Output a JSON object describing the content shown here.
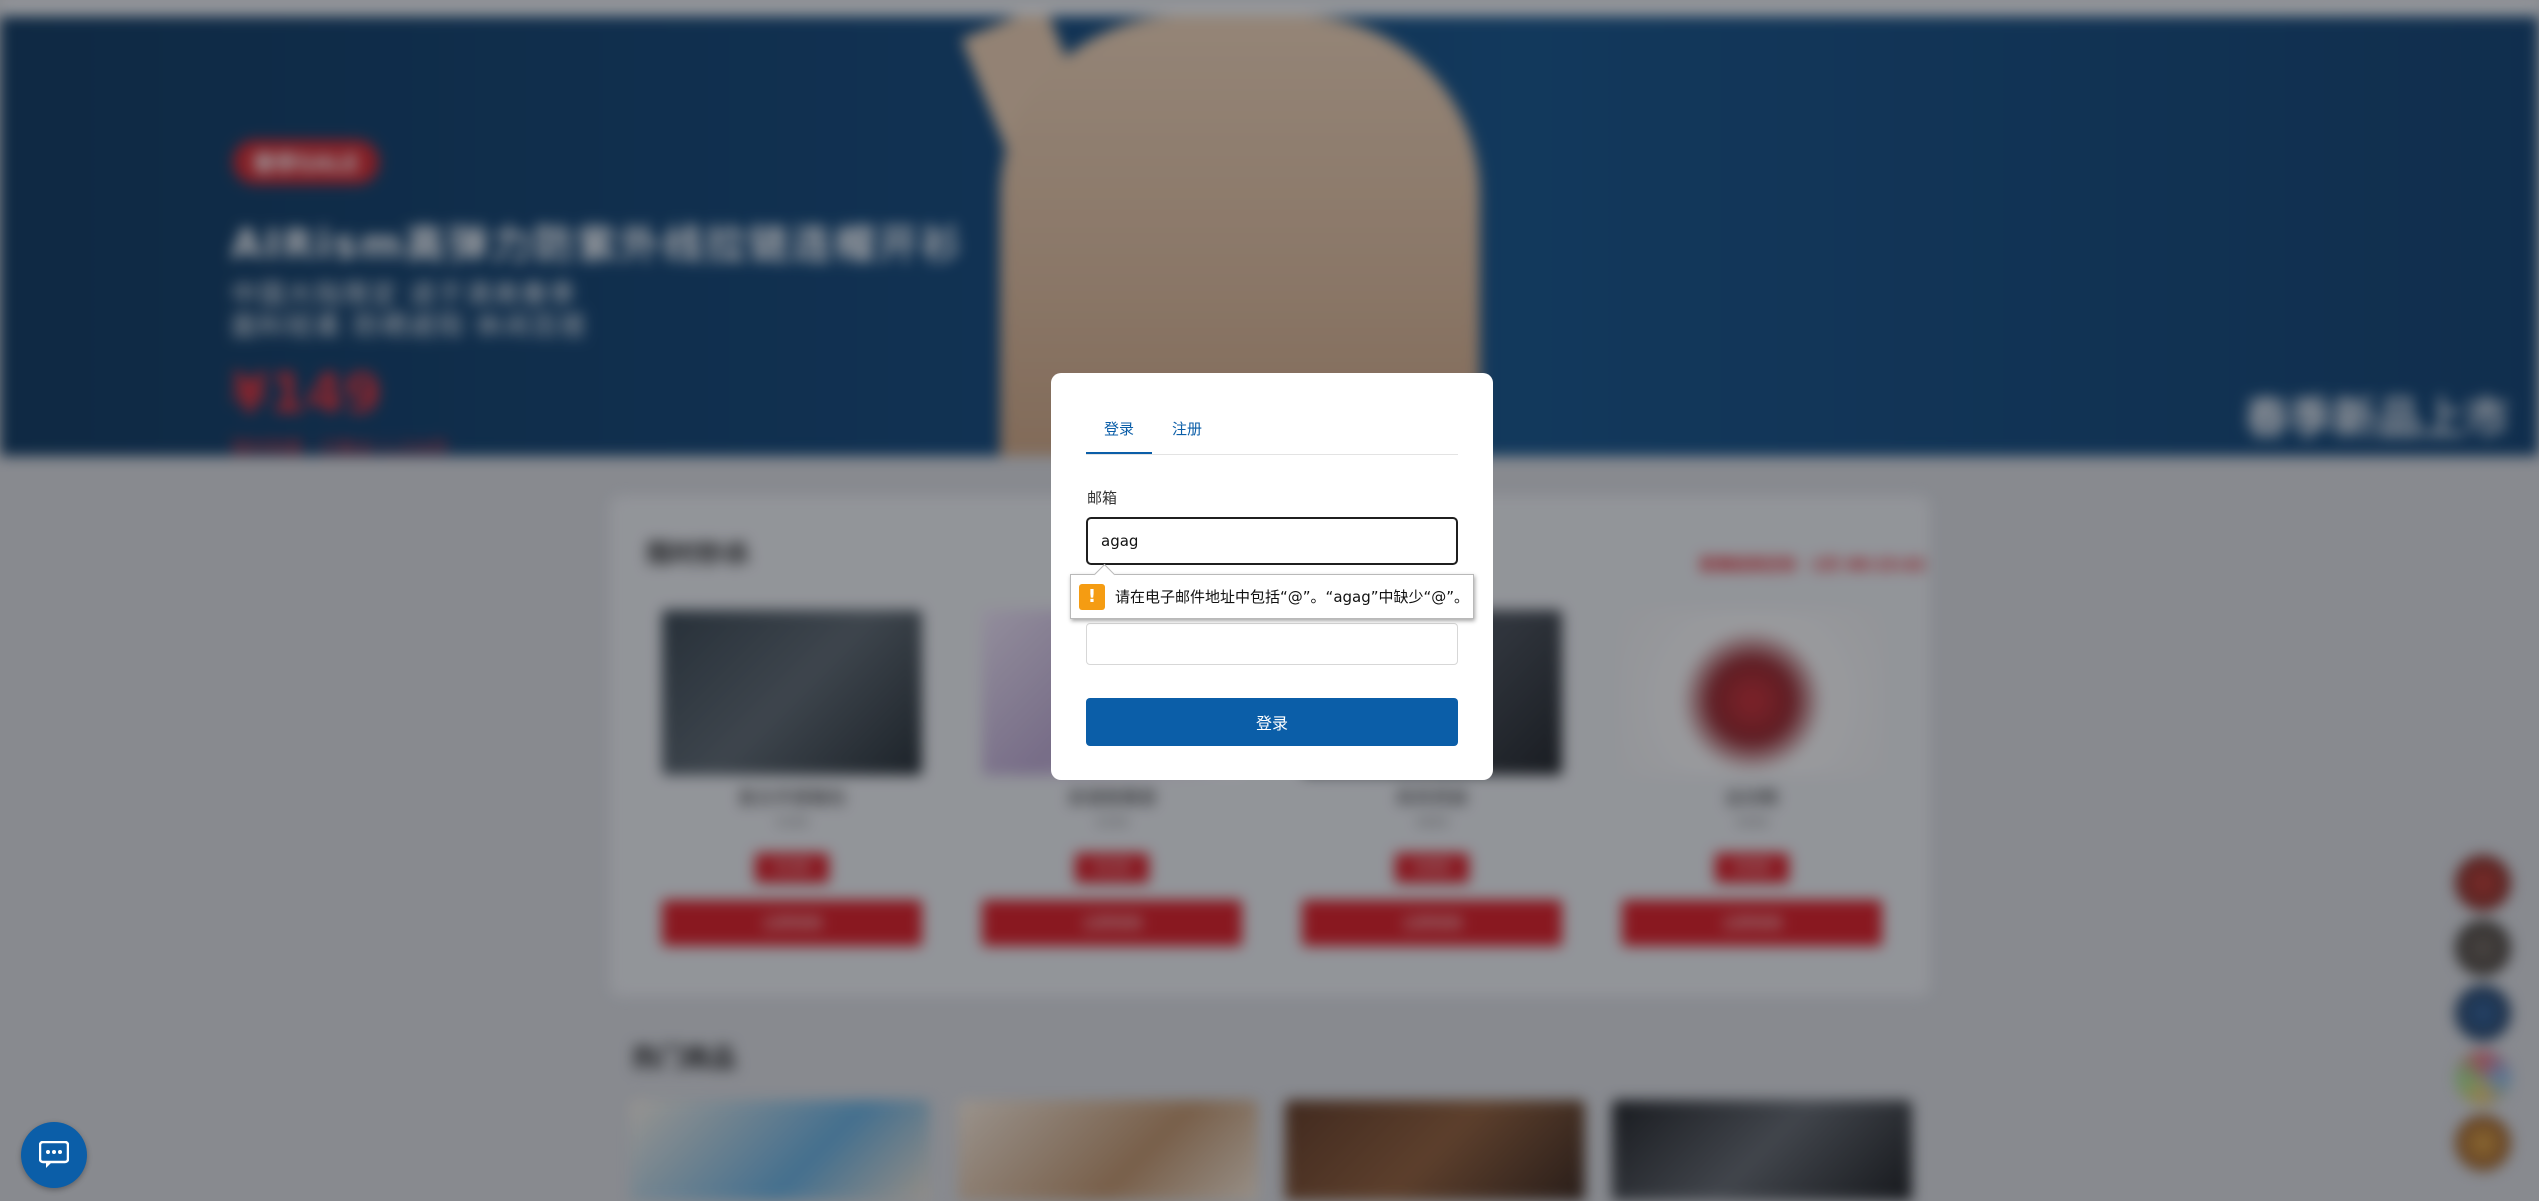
{
  "hero": {
    "badge": "春季SALE",
    "title": "AIRism高弹力防紫外线拉链连帽开衫",
    "subtitle_line1": "中国大陆限定 适于清爽春季",
    "subtitle_line2": "面料轻柔 防晒遮阳 休闲百搭",
    "price": "¥149",
    "price_note": "限时特惠 · 已售出 1,234件",
    "right_text": "春季新品上市"
  },
  "flash_sale": {
    "title": "限时秒杀",
    "timer": "距离结束还有 · 2天 08:15:42",
    "products": [
      {
        "name": "复古手提箱包",
        "meta": "¥399",
        "tag": "¥199",
        "buy": "立即抢购"
      },
      {
        "name": "浪漫香薰套",
        "meta": "¥299",
        "tag": "¥159",
        "buy": "立即抢购"
      },
      {
        "name": "商务西装",
        "meta": "¥899",
        "tag": "¥499",
        "buy": "立即抢购"
      },
      {
        "name": "运动鞋",
        "meta": "¥999",
        "tag": "¥599",
        "buy": "立即抢购"
      }
    ]
  },
  "hot": {
    "title": "热门商品"
  },
  "modal": {
    "tab_login": "登录",
    "tab_register": "注册",
    "email_label": "邮箱",
    "email_value": "agag",
    "login_button": "登录"
  },
  "validation": {
    "message": "请在电子邮件地址中包括“@”。“agag”中缺少“@”。",
    "icon": "!"
  },
  "colors": {
    "primary": "#0b5ea8",
    "sale_red": "#d6121b",
    "warning": "#f59c12"
  },
  "icons": {
    "chat": "chat-bubble-icon",
    "warning": "warning-icon"
  }
}
